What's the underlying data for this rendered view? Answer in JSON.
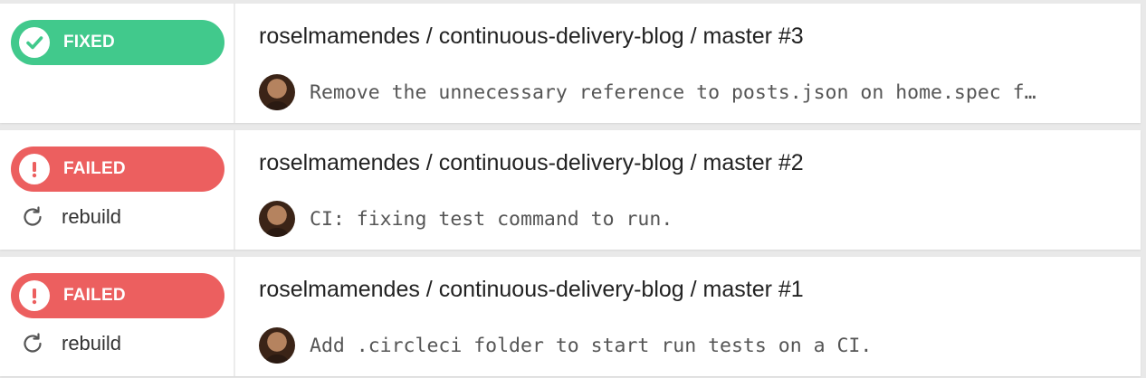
{
  "colors": {
    "fixed": "#41c98c",
    "failed": "#ec5f5f",
    "icon_gray": "#555555"
  },
  "builds": [
    {
      "status": "FIXED",
      "status_icon": "check-icon",
      "title": "roselmamendes / continuous-delivery-blog / master #3",
      "commit_message": "Remove the unnecessary reference to posts.json on home.spec f…",
      "rebuild_label": null
    },
    {
      "status": "FAILED",
      "status_icon": "exclamation-icon",
      "title": "roselmamendes / continuous-delivery-blog / master #2",
      "commit_message": "CI: fixing test command to run.",
      "rebuild_label": "rebuild"
    },
    {
      "status": "FAILED",
      "status_icon": "exclamation-icon",
      "title": "roselmamendes / continuous-delivery-blog / master #1",
      "commit_message": "Add .circleci folder to start run tests on a CI.",
      "rebuild_label": "rebuild"
    }
  ]
}
